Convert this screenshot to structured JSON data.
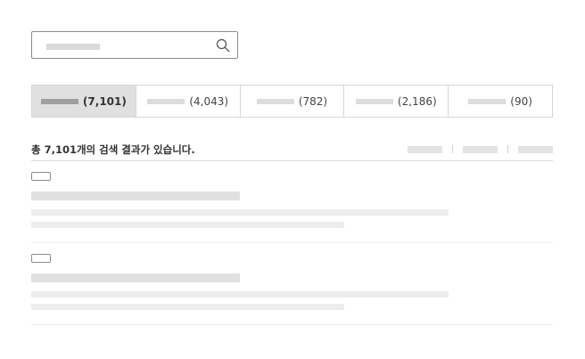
{
  "search": {
    "icon": "search-icon"
  },
  "tabs": [
    {
      "count": "(7,101)",
      "active": true
    },
    {
      "count": "(4,043)",
      "active": false
    },
    {
      "count": "(782)",
      "active": false
    },
    {
      "count": "(2,186)",
      "active": false
    },
    {
      "count": "(90)",
      "active": false
    }
  ],
  "results_header": {
    "count_text": "총 7,101개의 검색 결과가 있습니다."
  },
  "colors": {
    "active_tab_bg": "#e0e0e0",
    "border": "#d6d6d6"
  }
}
